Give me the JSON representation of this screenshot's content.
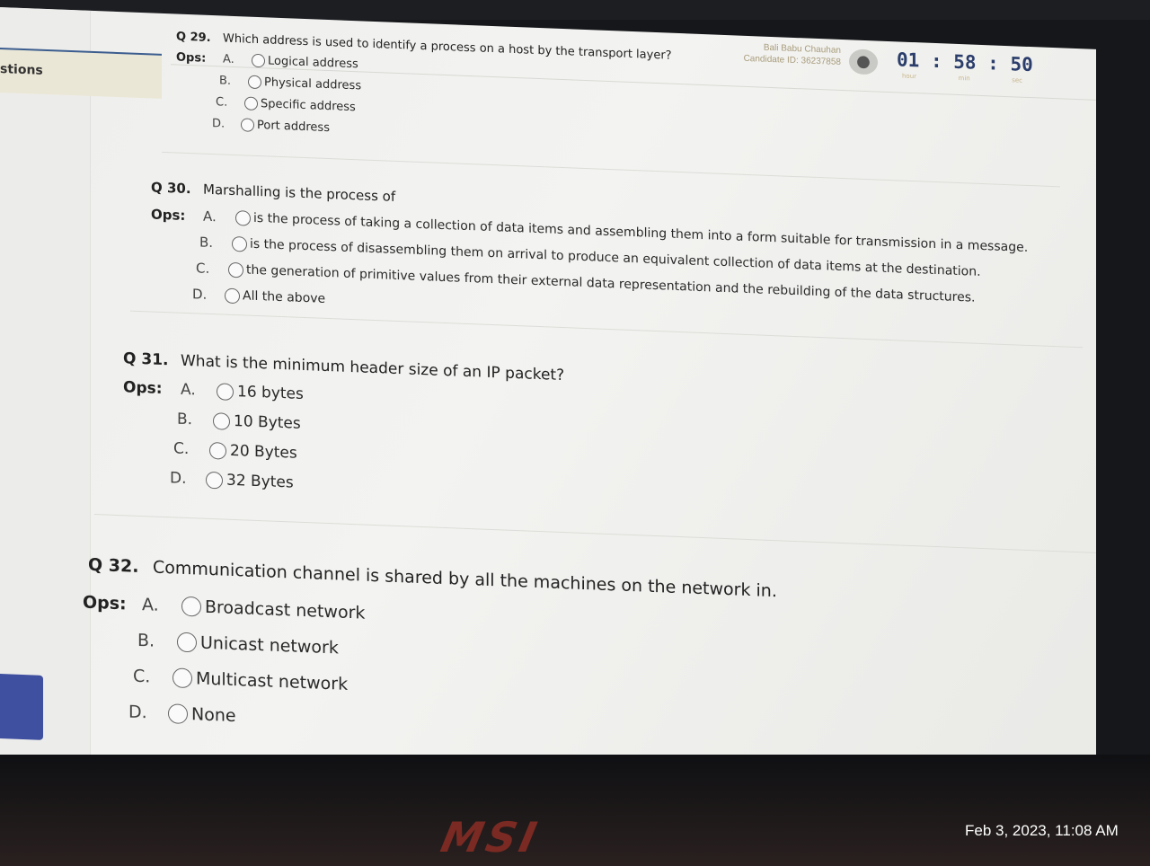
{
  "candidate": {
    "name": "Bali Babu Chauhan",
    "id_label": "Candidate ID: 36237858"
  },
  "timer": {
    "hours": "01",
    "minutes": "58",
    "seconds": "50",
    "units": [
      "hour",
      "min",
      "sec"
    ]
  },
  "sidebar": {
    "tab_label": "stions"
  },
  "questions": [
    {
      "number": "Q 29.",
      "text": "Which address is used to identify a process on a host by the transport layer?",
      "ops_label": "Ops:",
      "options": [
        {
          "letter": "A.",
          "text": "Logical address"
        },
        {
          "letter": "B.",
          "text": "Physical address"
        },
        {
          "letter": "C.",
          "text": "Specific address"
        },
        {
          "letter": "D.",
          "text": "Port address"
        }
      ]
    },
    {
      "number": "Q 30.",
      "text": "Marshalling is the process of",
      "ops_label": "Ops:",
      "options": [
        {
          "letter": "A.",
          "text": "is the process of taking a collection of data items and assembling them into a form suitable for transmission in a message."
        },
        {
          "letter": "B.",
          "text": "is the process of disassembling them on arrival to produce an equivalent collection of data items at the destination."
        },
        {
          "letter": "C.",
          "text": "the generation of primitive values from their external data representation and the rebuilding of the data structures."
        },
        {
          "letter": "D.",
          "text": "All the above"
        }
      ]
    },
    {
      "number": "Q 31.",
      "text": "What is the minimum header size of an IP packet?",
      "ops_label": "Ops:",
      "options": [
        {
          "letter": "A.",
          "text": "16 bytes"
        },
        {
          "letter": "B.",
          "text": "10 Bytes"
        },
        {
          "letter": "C.",
          "text": "20 Bytes"
        },
        {
          "letter": "D.",
          "text": "32 Bytes"
        }
      ]
    },
    {
      "number": "Q 32.",
      "text": "Communication channel is shared by all the machines on the network in.",
      "ops_label": "Ops:",
      "options": [
        {
          "letter": "A.",
          "text": "Broadcast network"
        },
        {
          "letter": "B.",
          "text": "Unicast network"
        },
        {
          "letter": "C.",
          "text": "Multicast network"
        },
        {
          "letter": "D.",
          "text": "None"
        }
      ]
    }
  ],
  "laptop": {
    "brand": "MSI"
  },
  "photo_timestamp": "Feb 3, 2023, 11:08 AM"
}
